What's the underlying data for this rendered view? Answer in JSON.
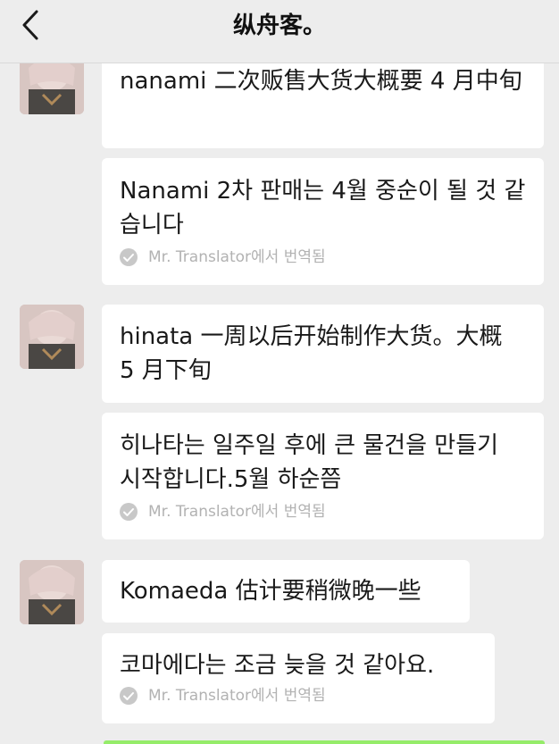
{
  "header": {
    "title": "纵舟客。",
    "back_icon": "chevron-left-icon"
  },
  "messages": [
    {
      "text": "nanami 二次贩售大货大概要 4 月中旬",
      "translation": "Nanami 2차 판매는 4월 중순이 될 것 같습니다",
      "translator_note": "Mr. Translator에서 번역됨"
    },
    {
      "text": "hinata 一周以后开始制作大货。大概 5 月下旬",
      "translation": "히나타는 일주일 후에 큰 물건을 만들기 시작합니다.5월 하순쯤",
      "translator_note": "Mr. Translator에서 번역됨"
    },
    {
      "text": "Komaeda 估计要稍微晚一些",
      "translation": "코마에다는 조금 늦을 것 같아요.",
      "translator_note": "Mr. Translator에서 번역됨"
    }
  ],
  "colors": {
    "background": "#ededed",
    "bubble": "#ffffff",
    "note": "#b2b2b2",
    "sent_bubble": "#95ec69"
  }
}
